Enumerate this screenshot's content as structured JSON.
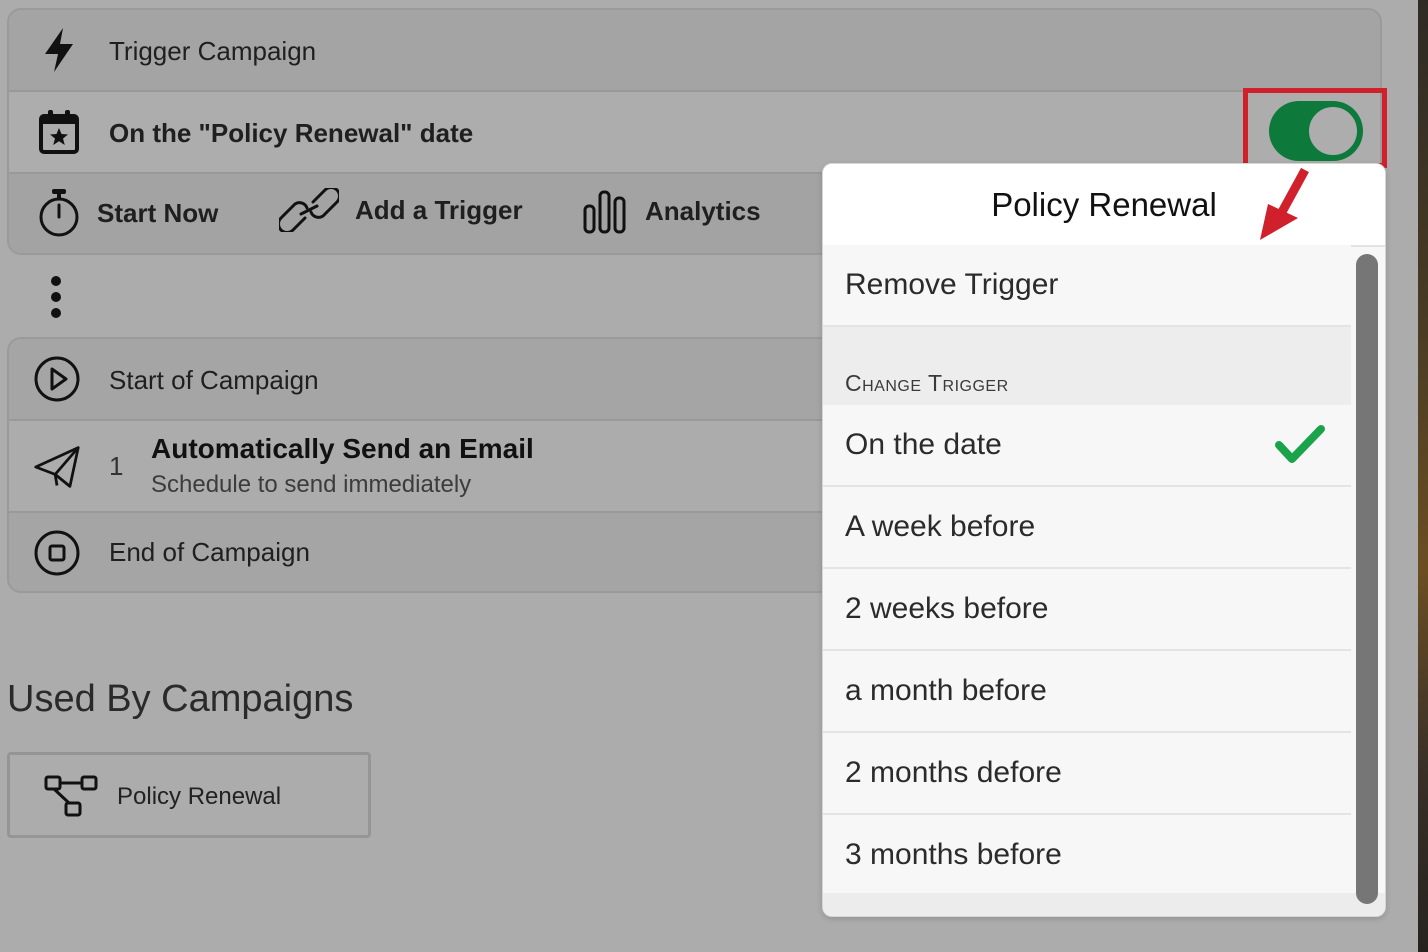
{
  "trigger_card": {
    "header_label": "Trigger Campaign",
    "trigger_label": "On the \"Policy Renewal\" date",
    "toolbar": {
      "start_now": "Start Now",
      "add_trigger": "Add a Trigger",
      "analytics": "Analytics"
    },
    "toggle_state": "on"
  },
  "campaign_steps": {
    "start_label": "Start of Campaign",
    "step_number": "1",
    "step_title": "Automatically Send an Email",
    "step_subtitle": "Schedule to send immediately",
    "end_label": "End of Campaign"
  },
  "used_by": {
    "title": "Used By Campaigns",
    "campaign_name": "Policy Renewal"
  },
  "popover": {
    "title": "Policy Renewal",
    "remove_trigger": "Remove Trigger",
    "section_header": "Change Trigger",
    "options": [
      {
        "label": "On the date",
        "selected": true
      },
      {
        "label": "A week before",
        "selected": false
      },
      {
        "label": "2 weeks before",
        "selected": false
      },
      {
        "label": "a month before",
        "selected": false
      },
      {
        "label": "2 months defore",
        "selected": false
      },
      {
        "label": "3 months before",
        "selected": false
      }
    ]
  },
  "colors": {
    "toggle_on": "#0d7a3c",
    "highlight": "#d0202c",
    "check": "#1aa34a",
    "background": "#acacac"
  },
  "icons": [
    "lightning-icon",
    "calendar-star-icon",
    "stopwatch-icon",
    "link-icon",
    "bar-chart-icon",
    "more-vertical-icon",
    "play-circle-icon",
    "send-icon",
    "stop-circle-icon",
    "workflow-icon",
    "checkmark-icon"
  ]
}
